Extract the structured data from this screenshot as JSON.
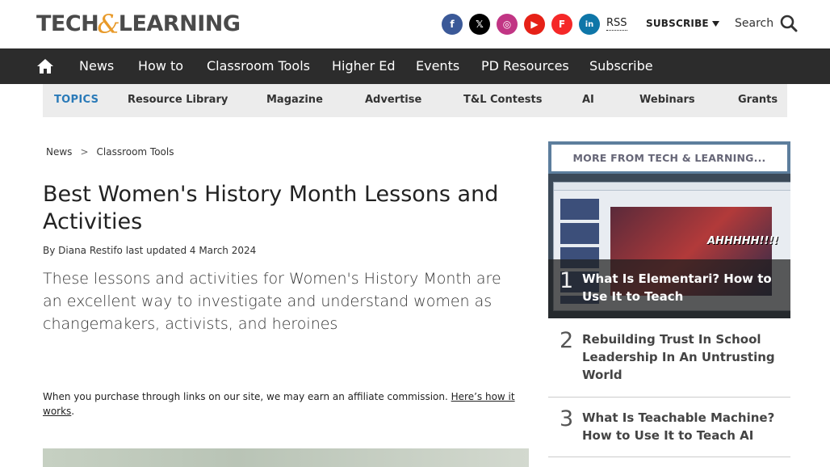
{
  "header": {
    "logo_left": "TECH",
    "logo_amp": "&",
    "logo_right": "LEARNING",
    "socials": [
      {
        "name": "facebook",
        "glyph": "f"
      },
      {
        "name": "x",
        "glyph": "𝕏"
      },
      {
        "name": "instagram",
        "glyph": "◎"
      },
      {
        "name": "youtube",
        "glyph": "▶"
      },
      {
        "name": "flipboard",
        "glyph": "F"
      },
      {
        "name": "linkedin",
        "glyph": "in"
      }
    ],
    "rss": "RSS",
    "subscribe": "SUBSCRIBE",
    "search": "Search"
  },
  "nav": {
    "items": [
      "News",
      "How to",
      "Classroom Tools",
      "Higher Ed",
      "Events",
      "PD Resources",
      "Subscribe"
    ]
  },
  "topics": {
    "label": "TOPICS",
    "items": [
      "Resource Library",
      "Magazine",
      "Advertise",
      "T&L Contests",
      "AI",
      "Webinars",
      "Grants"
    ]
  },
  "breadcrumb": {
    "items": [
      "News",
      "Classroom Tools"
    ],
    "separator": ">"
  },
  "article": {
    "title": "Best Women's History Month Lessons and Activities",
    "byline": "By Diana Restifo last updated 4 March 2024",
    "strapline": "These lessons and activities for Women's History Month are an excellent way to investigate and understand women as changemakers, activists, and heroines",
    "affiliate_text": "When you purchase through links on our site, we may earn an affiliate commission.",
    "affiliate_link": "Here’s how it works",
    "affiliate_end": "."
  },
  "sidebar": {
    "heading": "MORE FROM TECH & LEARNING...",
    "image_caption_text": "AHHHHH!!!!",
    "items": [
      {
        "rank": "1",
        "title": "What Is Elementari? How to Use It to Teach"
      },
      {
        "rank": "2",
        "title": "Rebuilding Trust In School Leadership In An Untrusting World"
      },
      {
        "rank": "3",
        "title": "What Is Teachable Machine? How to Use It to Teach AI"
      }
    ]
  },
  "colors": {
    "nav_bg": "#2c2c2c",
    "topics_label": "#2a7ab8",
    "sidebar_head": "#5d7e9d"
  }
}
